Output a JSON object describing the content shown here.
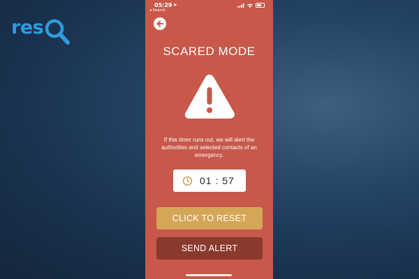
{
  "brand": {
    "logo_text": "res"
  },
  "status_bar": {
    "time": "05:29",
    "back_app": "◂ Search"
  },
  "screen": {
    "title": "SCARED MODE",
    "message": "If this timer runs out, we will alert the authorities and selected contacts of an emergency.",
    "timer": "01 : 57",
    "reset_label": "CLICK TO RESET",
    "alert_label": "SEND ALERT"
  },
  "colors": {
    "screen_bg": "#c7584a",
    "reset_button": "#d4a657",
    "alert_button": "#8a3a2c",
    "logo": "#2f9be0"
  }
}
